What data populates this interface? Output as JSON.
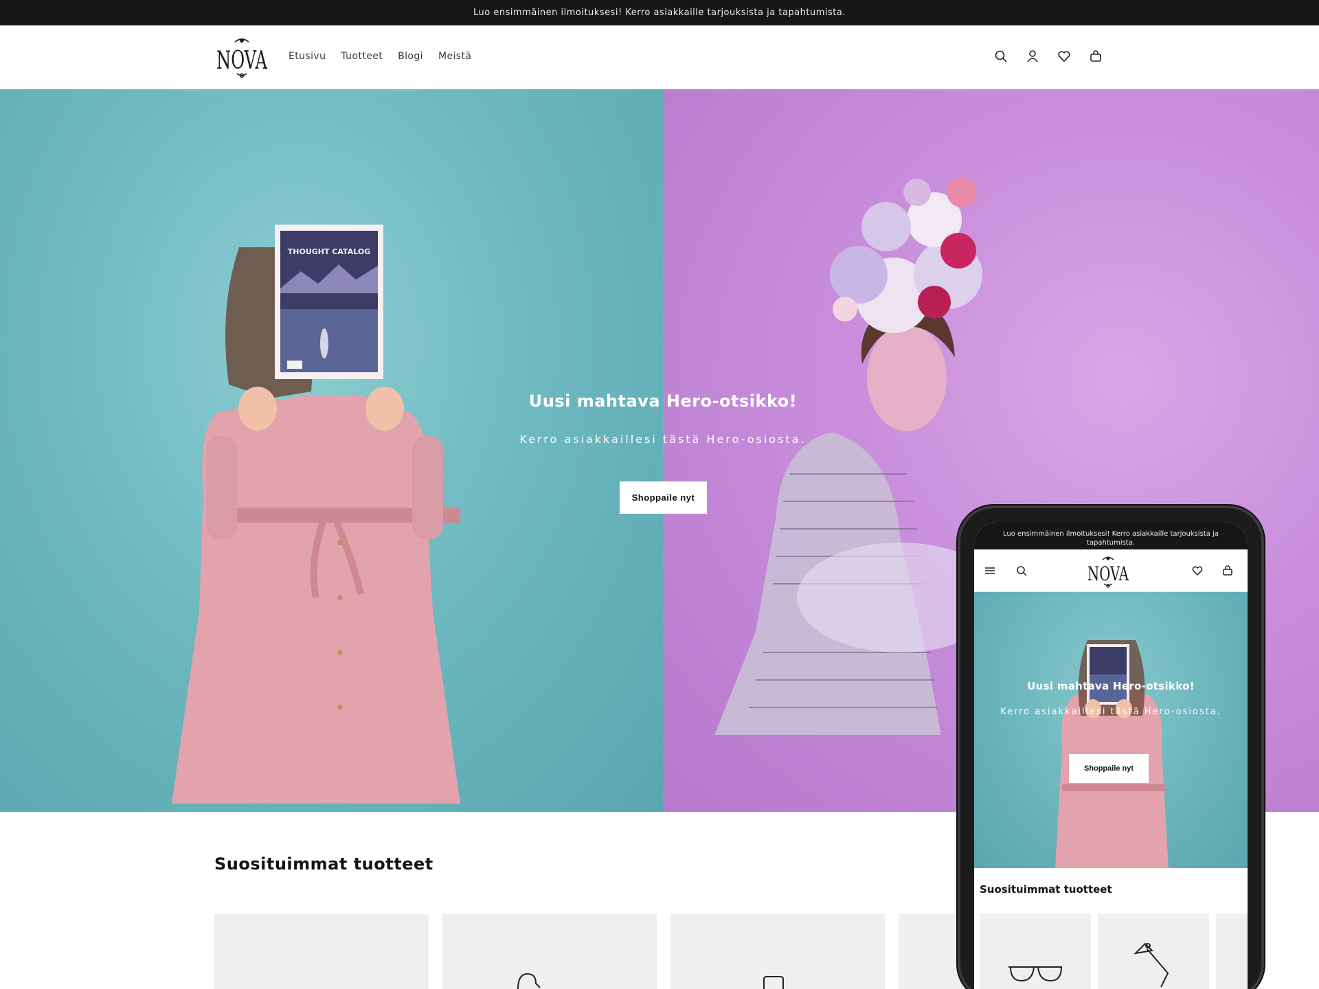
{
  "announcement": {
    "text": "Luo ensimmäinen ilmoituksesi! Kerro asiakkaille tarjouksista ja tapahtumista."
  },
  "header": {
    "logo_text": "NOVA",
    "nav": [
      "Etusivu",
      "Tuotteet",
      "Blogi",
      "Meistä"
    ],
    "icons": [
      "search-icon",
      "account-icon",
      "wishlist-heart-icon",
      "cart-bag-icon"
    ]
  },
  "hero": {
    "title": "Uusi mahtava Hero-otsikko!",
    "subtitle": "Kerro asiakkaillesi tästä Hero-osiosta.",
    "button": "Shoppaile nyt",
    "magazine_title": "THOUGHT CATALOG",
    "colors": {
      "left_bg": "#6fb9c1",
      "right_bg": "#c98fdc"
    }
  },
  "products": {
    "title": "Suosituimmat tuotteet"
  },
  "mobile": {
    "announcement": "Luo ensimmäinen ilmoituksesi! Kerro asiakkaille tarjouksista ja tapahtumista.",
    "logo_text": "NOVA",
    "hero_title": "Uusi mahtava Hero-otsikko!",
    "hero_subtitle": "Kerro asiakkaillesi tästä Hero-osiosta.",
    "hero_button": "Shoppaile nyt",
    "products_title": "Suosituimmat tuotteet",
    "icons": [
      "menu-icon",
      "search-icon",
      "wishlist-heart-icon",
      "cart-bag-icon"
    ]
  }
}
